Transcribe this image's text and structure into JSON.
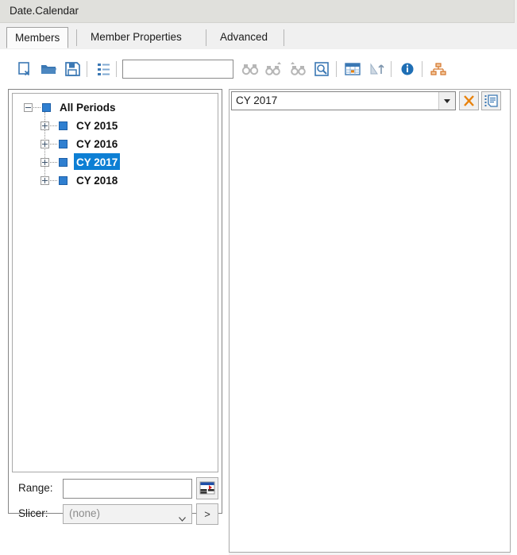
{
  "window": {
    "title": "Date.Calendar"
  },
  "tabs": [
    {
      "label": "Members",
      "selected": true
    },
    {
      "label": "Member Properties",
      "selected": false
    },
    {
      "label": "Advanced",
      "selected": false
    }
  ],
  "toolbar": {
    "buttons": [
      {
        "name": "new-document-icon",
        "label": "New",
        "enabled": true
      },
      {
        "name": "open-folder-icon",
        "label": "Open",
        "enabled": true
      },
      {
        "name": "save-icon",
        "label": "Save",
        "enabled": true
      },
      {
        "name": "list-view-icon",
        "label": "List View",
        "enabled": true
      },
      {
        "name": "find-icon",
        "label": "Find",
        "enabled": false
      },
      {
        "name": "find-next-icon",
        "label": "Find Next",
        "enabled": false
      },
      {
        "name": "find-previous-icon",
        "label": "Find Previous",
        "enabled": false
      },
      {
        "name": "search-in-selection-icon",
        "label": "Search In Selection",
        "enabled": true
      },
      {
        "name": "calendar-grid-icon",
        "label": "Calendar",
        "enabled": true
      },
      {
        "name": "sort-ascending-icon",
        "label": "Sort Ascending",
        "enabled": false
      },
      {
        "name": "info-icon",
        "label": "Info",
        "enabled": true
      },
      {
        "name": "hierarchy-icon",
        "label": "Hierarchy",
        "enabled": true
      }
    ],
    "search": {
      "value": "",
      "placeholder": ""
    }
  },
  "tree": {
    "root": {
      "label": "All Periods",
      "expanded": true,
      "selected": false
    },
    "children": [
      {
        "label": "CY 2015",
        "expanded": false,
        "selected": false
      },
      {
        "label": "CY 2016",
        "expanded": false,
        "selected": false
      },
      {
        "label": "CY 2017",
        "expanded": false,
        "selected": true
      },
      {
        "label": "CY 2018",
        "expanded": false,
        "selected": false
      }
    ]
  },
  "range": {
    "label": "Range:",
    "value": "",
    "placeholder": "",
    "button_name": "range-picker-icon"
  },
  "slicer": {
    "label": "Slicer:",
    "value": "(none)",
    "options": [
      "(none)"
    ],
    "go_label": ">"
  },
  "selection_panel": {
    "combo_value": "CY 2017",
    "clear_label": "✕",
    "clear_color": "#e8820c",
    "edit_button_name": "edit-list-icon",
    "items": []
  },
  "colors": {
    "titlebar": "#e0e0dc",
    "tabstrip": "#f0f0f0",
    "selection_blue": "#0d7fd4",
    "icon_blue": "#3b78b4",
    "icon_gray": "#b6b6b6",
    "accent_orange": "#e8820c"
  }
}
